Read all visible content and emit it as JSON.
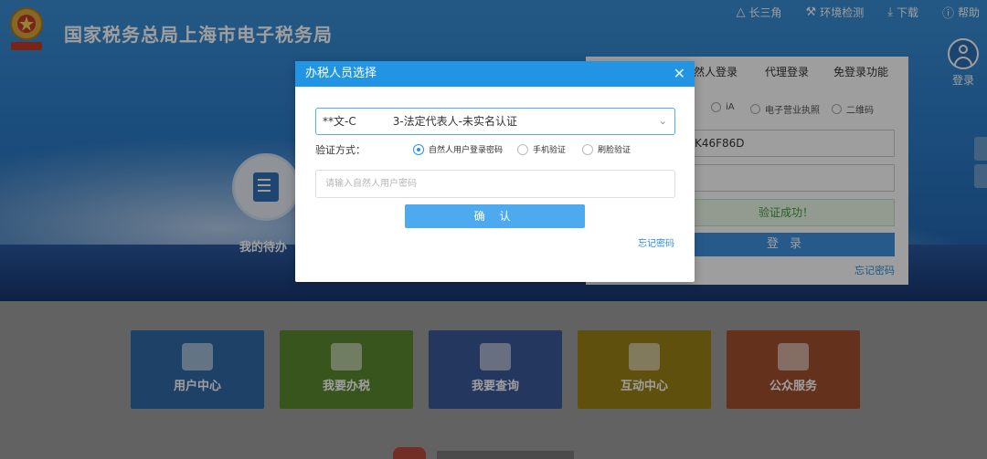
{
  "site": {
    "title": "国家税务总局上海市电子税务局"
  },
  "topnav": [
    {
      "icon": "triangle-icon",
      "label": "长三角"
    },
    {
      "icon": "wrench-icon",
      "label": "环境检测"
    },
    {
      "icon": "download-icon",
      "label": "下载"
    },
    {
      "icon": "help-icon",
      "label": "帮助"
    }
  ],
  "user": {
    "login_label": "登录"
  },
  "background": {
    "task_label": "我的待办",
    "login_tabs": [
      "然人登录",
      "代理登录",
      "免登录功能"
    ],
    "login_methods": [
      "iA",
      "电子营业执照",
      "二维码"
    ],
    "credit_code_value": "K46F86D",
    "verify_success": "验证成功！",
    "login_button": "登 录",
    "forgot_password": "忘记密码",
    "tiles": [
      {
        "label": "用户中心",
        "color": "#2f6aa6"
      },
      {
        "label": "我要办税",
        "color": "#5b8a2f"
      },
      {
        "label": "我要查询",
        "color": "#3a5a9a"
      },
      {
        "label": "互动中心",
        "color": "#9a8218"
      },
      {
        "label": "公众服务",
        "color": "#a2502e"
      }
    ]
  },
  "modal": {
    "title": "办税人员选择",
    "identity_prefix": "**文-C",
    "identity_suffix": "3-法定代表人-未实名认证",
    "verify_label": "验证方式：",
    "verify_options": [
      {
        "label": "自然人用户登录密码",
        "selected": true
      },
      {
        "label": "手机验证",
        "selected": false
      },
      {
        "label": "刷脸验证",
        "selected": false
      }
    ],
    "password_placeholder": "请输入自然人用户密码",
    "confirm_button": "确 认",
    "forgot_password": "忘记密码"
  },
  "colors": {
    "header_blue": "#2194e4",
    "button_blue": "#4daaee",
    "link_blue": "#2b8ee0",
    "success_green": "#3aa13a"
  }
}
